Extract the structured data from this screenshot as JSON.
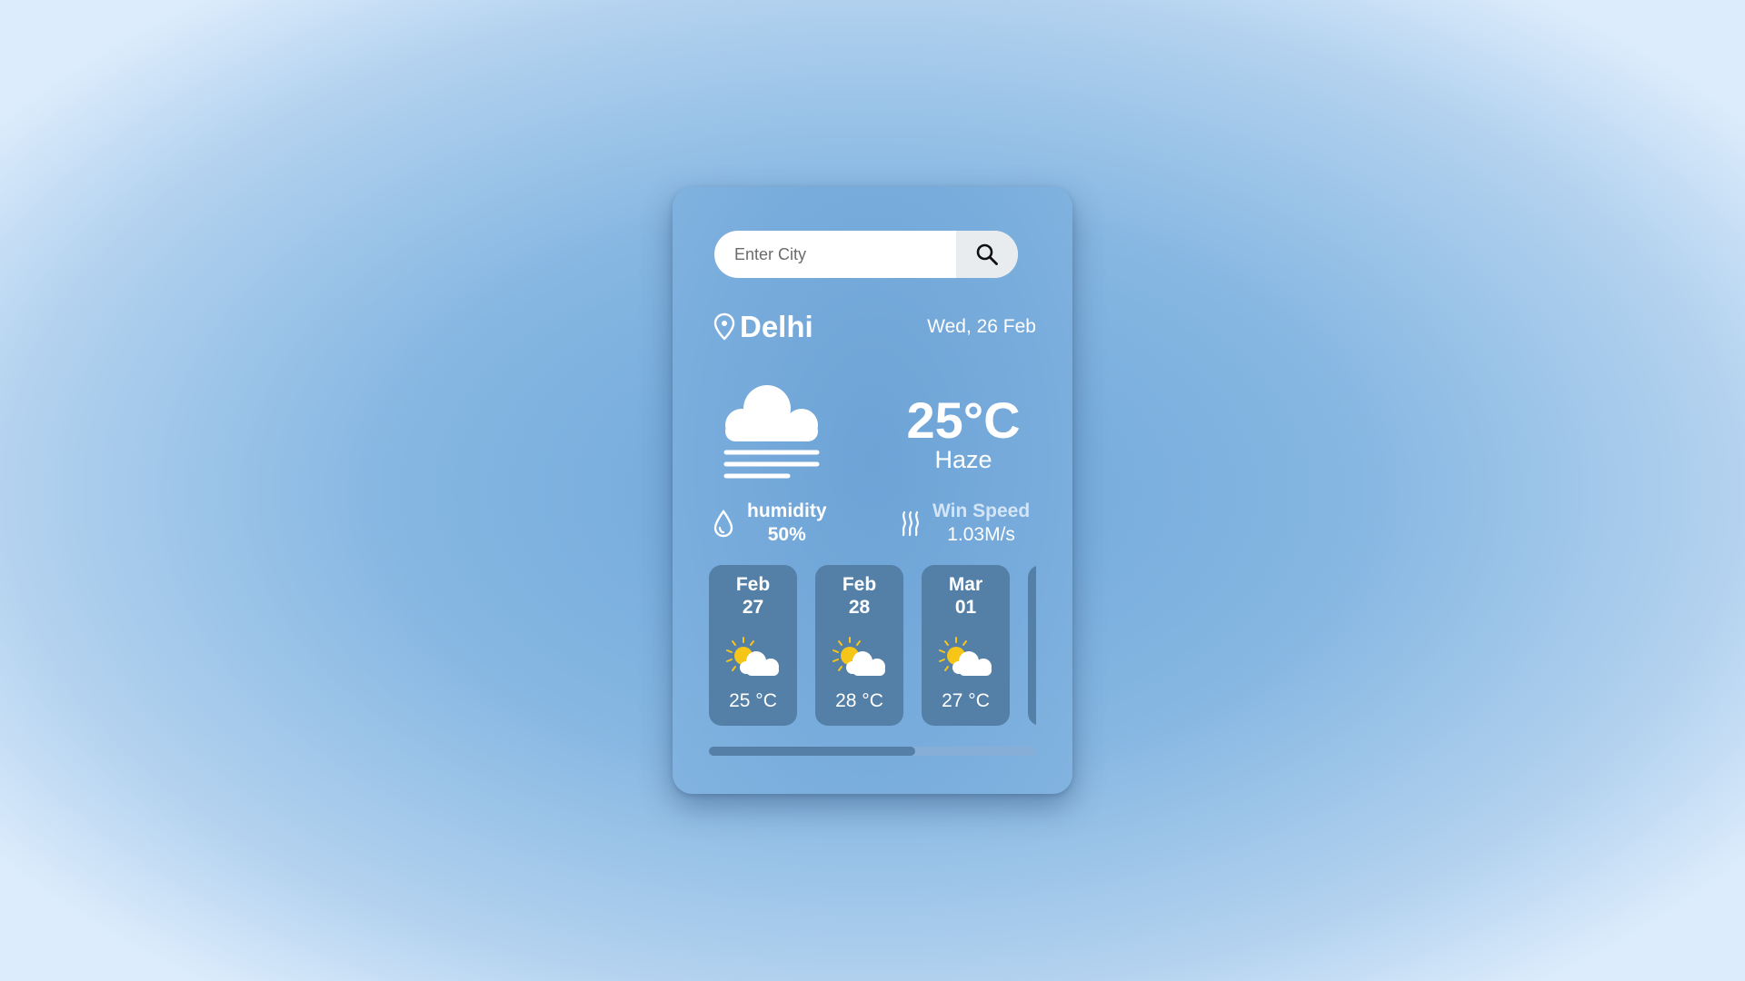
{
  "search": {
    "placeholder": "Enter City",
    "button_icon": "search-icon"
  },
  "location": {
    "icon": "map-pin-icon",
    "city": "Delhi",
    "date": "Wed, 26 Feb"
  },
  "current": {
    "icon": "haze-cloud-icon",
    "temperature": "25°C",
    "condition": "Haze"
  },
  "stats": {
    "humidity": {
      "icon": "droplet-icon",
      "label": "humidity",
      "value": "50%"
    },
    "wind": {
      "icon": "wind-icon",
      "label": "Win Speed",
      "value": "1.03M/s"
    }
  },
  "forecast": [
    {
      "month": "Feb",
      "day": "27",
      "icon": "partly-sunny-icon",
      "temp": "25 °C"
    },
    {
      "month": "Feb",
      "day": "28",
      "icon": "partly-sunny-icon",
      "temp": "28 °C"
    },
    {
      "month": "Mar",
      "day": "01",
      "icon": "partly-sunny-icon",
      "temp": "27 °C"
    }
  ],
  "forecast_scroll": {
    "visible_fraction": 0.63,
    "position": 0
  },
  "colors": {
    "card_bg": "#78acdc",
    "forecast_card_bg": "#5480a8",
    "sun": "#f5c518",
    "text": "#ffffff"
  }
}
